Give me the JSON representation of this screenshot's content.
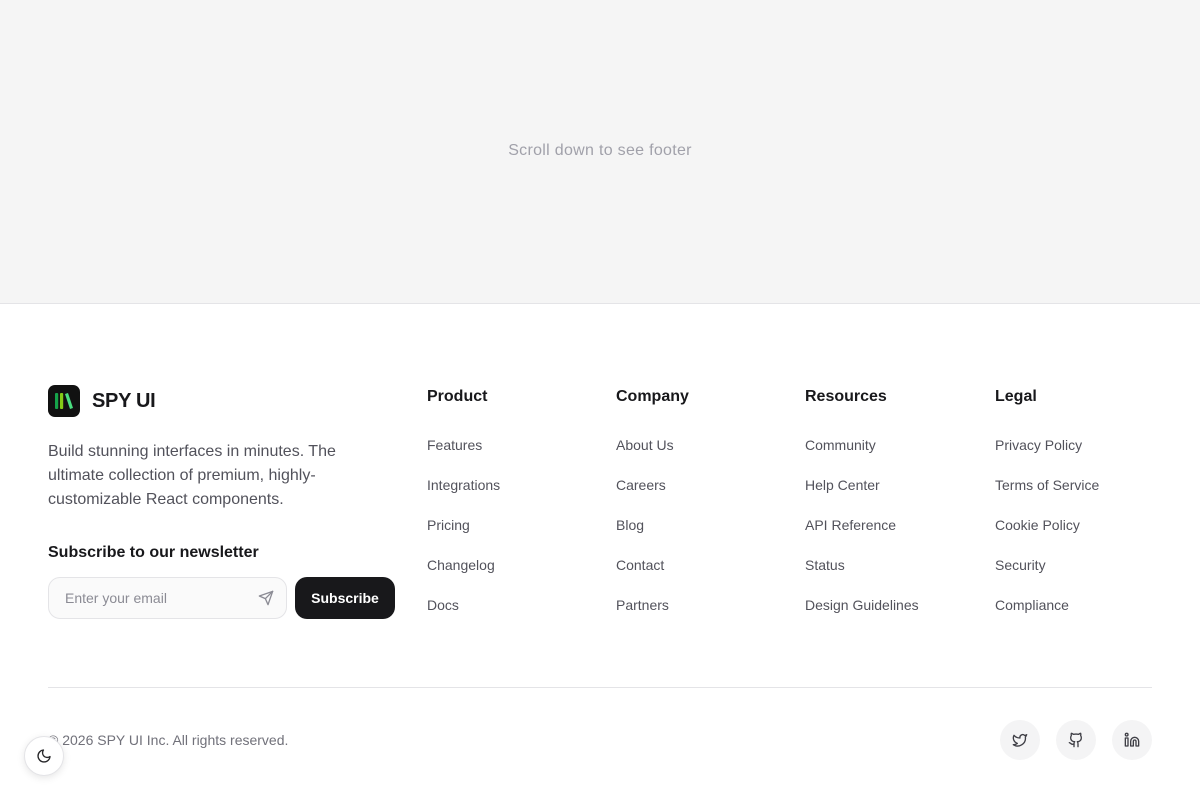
{
  "hero": {
    "text": "Scroll down to see footer"
  },
  "brand": {
    "name": "SPY UI",
    "description": "Build stunning interfaces in minutes. The ultimate collection of premium, highly-customizable React components."
  },
  "newsletter": {
    "title": "Subscribe to our newsletter",
    "placeholder": "Enter your email",
    "value": "",
    "button_label": "Subscribe"
  },
  "columns": [
    {
      "title": "Product",
      "links": [
        "Features",
        "Integrations",
        "Pricing",
        "Changelog",
        "Docs"
      ]
    },
    {
      "title": "Company",
      "links": [
        "About Us",
        "Careers",
        "Blog",
        "Contact",
        "Partners"
      ]
    },
    {
      "title": "Resources",
      "links": [
        "Community",
        "Help Center",
        "API Reference",
        "Status",
        "Design Guidelines"
      ]
    },
    {
      "title": "Legal",
      "links": [
        "Privacy Policy",
        "Terms of Service",
        "Cookie Policy",
        "Security",
        "Compliance"
      ]
    }
  ],
  "copyright": "© 2026 SPY UI Inc. All rights reserved.",
  "socials": [
    {
      "icon": "twitter-icon"
    },
    {
      "icon": "github-icon"
    },
    {
      "icon": "linkedin-icon"
    }
  ],
  "theme_toggle": {
    "icon": "moon-icon"
  },
  "colors": {
    "accent": "#18181b",
    "logo_green": "#4ade80",
    "logo_lime": "#a3e635",
    "hero_bg": "#f5f5f5"
  }
}
